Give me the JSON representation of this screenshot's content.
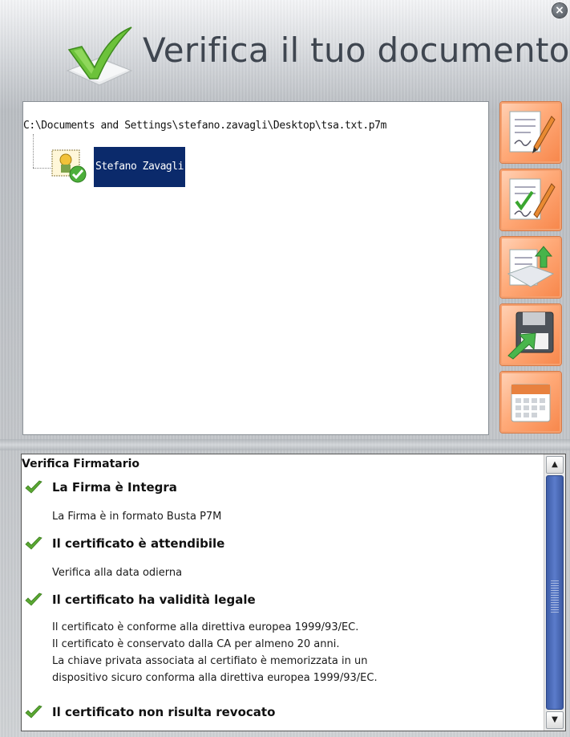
{
  "window": {
    "title": "Verifica il tuo documento",
    "close_symbol": "×"
  },
  "colors": {
    "accent_orange": "#f7864a",
    "selection_blue": "#0b2a6b",
    "check_green": "#5aa832",
    "scroll_blue": "#4a6cb8"
  },
  "tree": {
    "path": "C:\\Documents and Settings\\stefano.zavagli\\Desktop\\tsa.txt.p7m",
    "signer": "Stefano Zavagli",
    "signer_icon": "certificate-ok-icon"
  },
  "toolbar": {
    "buttons": [
      {
        "icon": "sign-document-icon"
      },
      {
        "icon": "verify-signature-icon"
      },
      {
        "icon": "extract-document-icon"
      },
      {
        "icon": "save-icon"
      },
      {
        "icon": "calendar-icon"
      }
    ]
  },
  "results": {
    "heading": "Verifica Firmatario",
    "items": [
      {
        "title": "La Firma è Integra",
        "lines": [
          "La Firma è in formato Busta P7M"
        ]
      },
      {
        "title": "Il certificato è attendibile",
        "lines": [
          "Verifica alla data odierna"
        ]
      },
      {
        "title": "Il certificato ha validità legale",
        "lines": [
          "Il certificato è conforme alla direttiva europea 1999/93/EC.",
          "Il certificato è conservato dalla CA per almeno 20 anni.",
          "La chiave privata associata al certifiato è memorizzata in un",
          "dispositivo sicuro conforma alla direttiva europea 1999/93/EC."
        ]
      },
      {
        "title": "Il certificato non risulta revocato",
        "lines": []
      }
    ]
  }
}
